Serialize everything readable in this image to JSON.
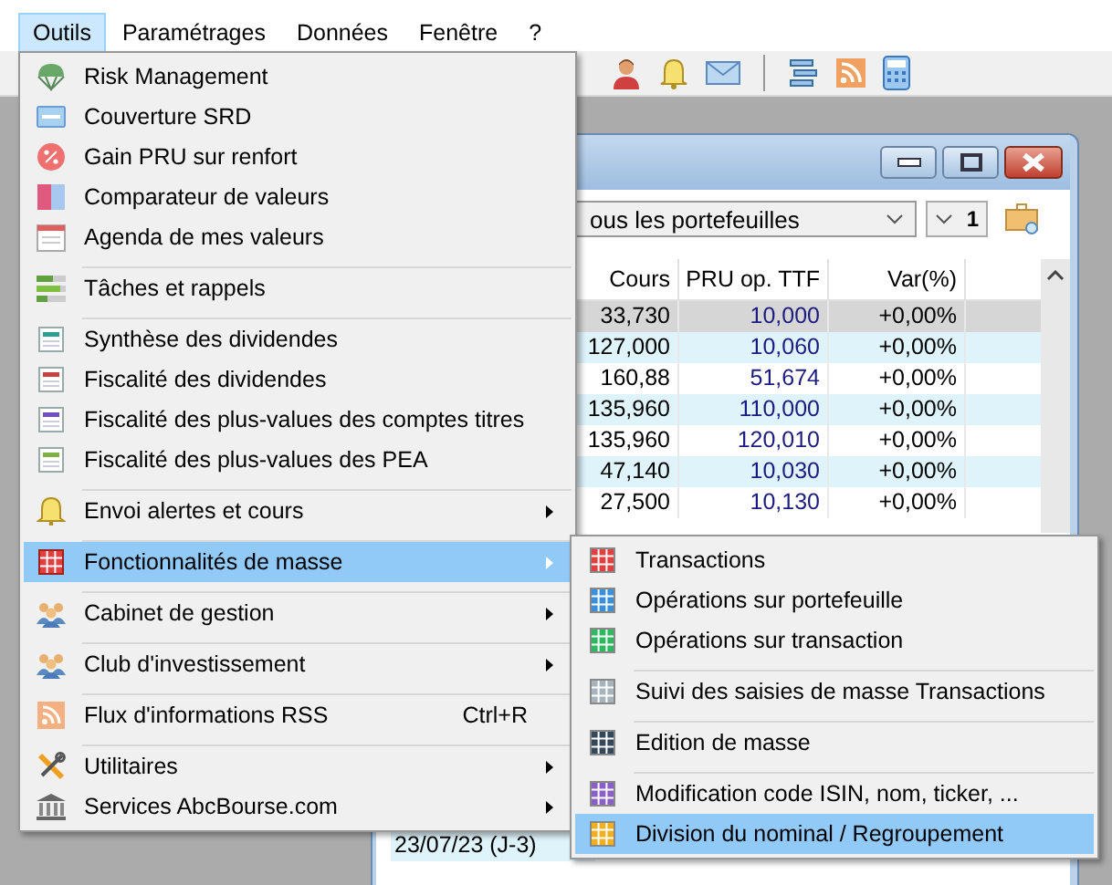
{
  "menubar": [
    {
      "label": "Outils",
      "selected": true
    },
    {
      "label": "Paramétrages",
      "selected": false
    },
    {
      "label": "Données",
      "selected": false
    },
    {
      "label": "Fenêtre",
      "selected": false
    },
    {
      "label": "?",
      "selected": false
    }
  ],
  "menu": [
    {
      "kind": "item",
      "label": "Risk Management",
      "has_submenu": false,
      "selected": false
    },
    {
      "kind": "item",
      "label": "Couverture SRD",
      "has_submenu": false,
      "selected": false
    },
    {
      "kind": "item",
      "label": "Gain PRU sur renfort",
      "has_submenu": false,
      "selected": false
    },
    {
      "kind": "item",
      "label": "Comparateur de valeurs",
      "has_submenu": false,
      "selected": false
    },
    {
      "kind": "item",
      "label": "Agenda de mes valeurs",
      "has_submenu": false,
      "selected": false
    },
    {
      "kind": "separator"
    },
    {
      "kind": "item",
      "label": "Tâches et rappels",
      "has_submenu": false,
      "selected": false
    },
    {
      "kind": "separator"
    },
    {
      "kind": "item",
      "label": "Synthèse des dividendes",
      "has_submenu": false,
      "selected": false
    },
    {
      "kind": "item",
      "label": "Fiscalité des dividendes",
      "has_submenu": false,
      "selected": false
    },
    {
      "kind": "item",
      "label": "Fiscalité des plus-values des comptes titres",
      "has_submenu": false,
      "selected": false
    },
    {
      "kind": "item",
      "label": "Fiscalité des plus-values des PEA",
      "has_submenu": false,
      "selected": false
    },
    {
      "kind": "separator"
    },
    {
      "kind": "item",
      "label": "Envoi alertes et cours",
      "has_submenu": true,
      "selected": false
    },
    {
      "kind": "separator"
    },
    {
      "kind": "item",
      "label": "Fonctionnalités de masse",
      "has_submenu": true,
      "selected": true
    },
    {
      "kind": "separator"
    },
    {
      "kind": "item",
      "label": "Cabinet de gestion",
      "has_submenu": true,
      "selected": false
    },
    {
      "kind": "separator"
    },
    {
      "kind": "item",
      "label": "Club d'investissement",
      "has_submenu": true,
      "selected": false
    },
    {
      "kind": "separator"
    },
    {
      "kind": "item",
      "label": "Flux d'informations RSS",
      "shortcut": "Ctrl+R",
      "has_submenu": false,
      "selected": false
    },
    {
      "kind": "separator"
    },
    {
      "kind": "item",
      "label": "Utilitaires",
      "has_submenu": true,
      "selected": false
    },
    {
      "kind": "item",
      "label": "Services AbcBourse.com",
      "has_submenu": true,
      "selected": false
    }
  ],
  "submenu": [
    {
      "kind": "item",
      "label": "Transactions",
      "color": "#e04040",
      "selected": false
    },
    {
      "kind": "item",
      "label": "Opérations sur portefeuille",
      "color": "#3a8fd8",
      "selected": false
    },
    {
      "kind": "item",
      "label": "Opérations sur transaction",
      "color": "#2eb860",
      "selected": false
    },
    {
      "kind": "separator"
    },
    {
      "kind": "item",
      "label": "Suivi des saisies de masse Transactions",
      "color": "#a8b4bc",
      "selected": false
    },
    {
      "kind": "separator"
    },
    {
      "kind": "item",
      "label": "Edition de masse",
      "color": "#34485c",
      "selected": false
    },
    {
      "kind": "separator"
    },
    {
      "kind": "item",
      "label": "Modification code ISIN, nom, ticker, ...",
      "color": "#8a60c8",
      "selected": false
    },
    {
      "kind": "item",
      "label": "Division du nominal / Regroupement",
      "color": "#f0b020",
      "selected": true
    }
  ],
  "portfolio_window": {
    "portfolio_select": {
      "value": "ous les portefeuilles"
    },
    "spin": {
      "value": "1"
    },
    "table": {
      "columns": [
        "Cours",
        "PRU op. TTF",
        "Var(%)"
      ],
      "rows": [
        {
          "cells": [
            "33,730",
            "10,000",
            "+0,00%"
          ],
          "selected": true
        },
        {
          "cells": [
            "127,000",
            "10,060",
            "+0,00%"
          ],
          "selected": false
        },
        {
          "cells": [
            "160,88",
            "51,674",
            "+0,00%"
          ],
          "selected": false
        },
        {
          "cells": [
            "135,960",
            "110,000",
            "+0,00%"
          ],
          "selected": false
        },
        {
          "cells": [
            "135,960",
            "120,010",
            "+0,00%"
          ],
          "selected": false
        },
        {
          "cells": [
            "47,140",
            "10,030",
            "+0,00%"
          ],
          "selected": false
        },
        {
          "cells": [
            "27,500",
            "10,130",
            "+0,00%"
          ],
          "selected": false
        }
      ]
    },
    "date_row": "23/07/23 (J-3)"
  }
}
